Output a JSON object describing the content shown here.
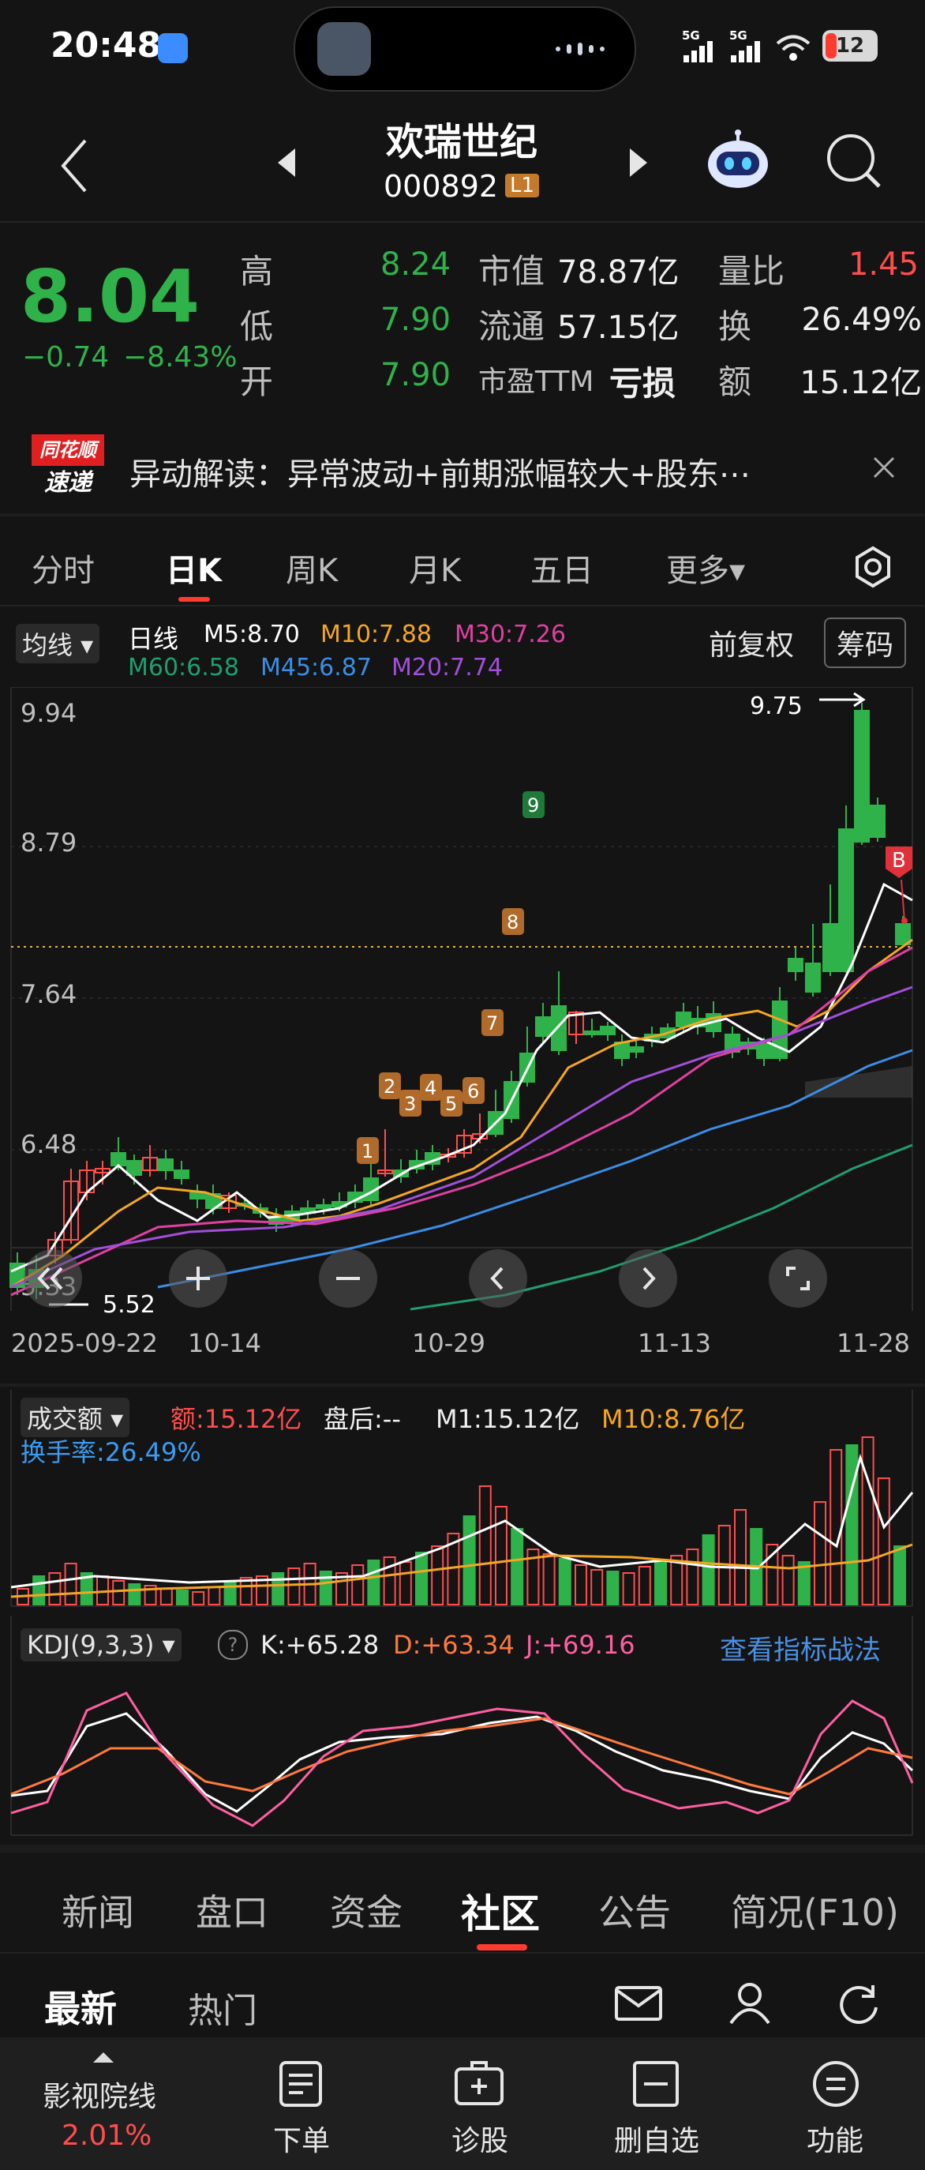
{
  "status_bar": {
    "time": "20:48",
    "signal1": "5G",
    "signal2": "5G",
    "battery": "12"
  },
  "header": {
    "stock_name": "欢瑞世纪",
    "stock_code": "000892",
    "level_badge": "L1"
  },
  "quote": {
    "price": "8.04",
    "change": "−0.74",
    "change_pct": "−8.43%",
    "high_label": "高",
    "high": "8.24",
    "low_label": "低",
    "low": "7.90",
    "open_label": "开",
    "open": "7.90",
    "mktcap_label": "市值",
    "mktcap": "78.87亿",
    "float_label": "流通",
    "float": "57.15亿",
    "pe_label": "市盈TTM",
    "pe": "亏损",
    "volratio_label": "量比",
    "volratio": "1.45",
    "turnover_label": "换",
    "turnover": "26.49%",
    "amount_label": "额",
    "amount": "15.12亿"
  },
  "banner": {
    "brand_top": "同花顺",
    "brand_bottom": "速递",
    "text": "异动解读：异常波动+前期涨幅较大+股东⋯"
  },
  "chart_tabs": [
    "分时",
    "日K",
    "周K",
    "月K",
    "五日",
    "更多▾"
  ],
  "active_chart_tab": "日K",
  "ma_bar": {
    "selector": "均线 ▾",
    "period": "日线",
    "m5": "M5:8.70",
    "m10": "M10:7.88",
    "m30": "M30:7.26",
    "m60": "M60:6.58",
    "m45": "M45:6.87",
    "m20": "M20:7.74",
    "fuquan": "前复权",
    "chouma": "筹码"
  },
  "kline": {
    "y_ticks": [
      "9.94",
      "8.79",
      "7.64",
      "6.48",
      "5.33"
    ],
    "high_marker": "9.75",
    "low_marker": "5.52",
    "x_ticks": [
      "2025-09-22",
      "10-14",
      "10-29",
      "11-13",
      "11-28"
    ],
    "seq_labels": [
      "1",
      "2",
      "3",
      "4",
      "5",
      "6",
      "7",
      "8",
      "9"
    ],
    "b_marker": "B"
  },
  "volume_panel": {
    "selector": "成交额 ▾",
    "amount": "额:15.12亿",
    "after_hours": "盘后:--",
    "m1": "M1:15.12亿",
    "m10": "M10:8.76亿",
    "turnover": "换手率:26.49%"
  },
  "kdj_panel": {
    "selector": "KDJ(9,3,3) ▾",
    "k": "K:+65.28",
    "d": "D:+63.34",
    "j": "J:+69.16",
    "link": "查看指标战法"
  },
  "section_tabs": [
    "新闻",
    "盘口",
    "资金",
    "社区",
    "公告",
    "简况(F10)"
  ],
  "active_section_tab": "社区",
  "sub_tabs": {
    "latest": "最新",
    "hot": "热门"
  },
  "bottom_nav": {
    "ticker_name": "影视院线",
    "ticker_pct": "2.01%",
    "order": "下单",
    "diagnose": "诊股",
    "remove_fav": "删自选",
    "functions": "功能"
  },
  "colors": {
    "up": "#ff4d4d",
    "down": "#2fb24a",
    "m5": "#ffffff",
    "m10": "#f5a623",
    "m30": "#e040a0",
    "m60": "#1f9e6e",
    "m45": "#3a8ee6",
    "m20": "#a24fd9",
    "link": "#4a90e2"
  }
}
